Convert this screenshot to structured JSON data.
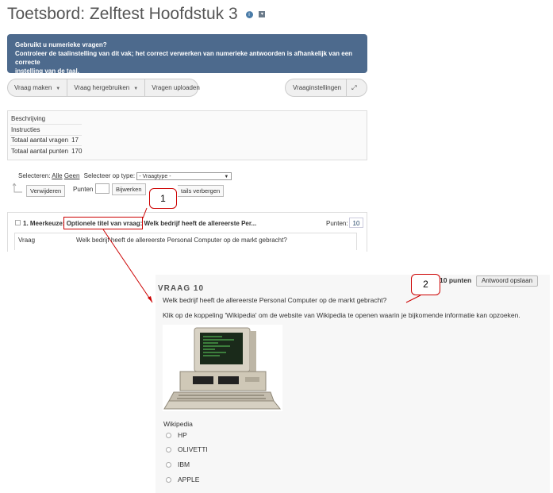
{
  "page": {
    "title": "Toetsbord: Zelftest Hoofdstuk 3"
  },
  "alert": {
    "line1": "Gebruikt u numerieke vragen?",
    "line2": "Controleer de taalinstelling van dit vak; het correct verwerken van numerieke antwoorden is afhankelijk van een correcte",
    "line3": "instelling van de taal."
  },
  "toolbar": {
    "vraag_maken": "Vraag maken",
    "vraag_hergebruiken": "Vraag hergebruiken",
    "vragen_uploaden": "Vragen uploaden",
    "vraaginstellingen": "Vraaginstellingen"
  },
  "info": {
    "beschrijving": "Beschrijving",
    "instructies": "Instructies",
    "totaal_vragen_label": "Totaal aantal vragen",
    "totaal_vragen": "17",
    "totaal_punten_label": "Totaal aantal punten",
    "totaal_punten": "170"
  },
  "selection": {
    "selecteren": "Selecteren:",
    "alle": "Alle",
    "geen": "Geen",
    "type_label": "Selecteer op type:",
    "type_value": "- Vraagtype -",
    "verwijderen": "Verwijderen",
    "punten": "Punten",
    "bijwerken": "Bijwerken",
    "details": "tails verbergen"
  },
  "question1": {
    "prefix": "1. Meerkeuze:",
    "optional_title": "Optionele titel van vraag:",
    "title_rest": "Welk bedrijf heeft de allereerste Per...",
    "points_label": "Punten:",
    "points": "10",
    "vraag_label": "Vraag",
    "vraag_text": "Welk bedrijf heeft de allereerste Personal Computer op de markt gebracht?"
  },
  "preview": {
    "heading": "VRAAG 10",
    "punten": "10 punten",
    "save": "Antwoord opslaan",
    "question": "Welk bedrijf heeft de allereerste Personal Computer op de markt gebracht?",
    "instruction": "Klik op de koppeling 'Wikipedia' om de website van Wikipedia te openen waarin je bijkomende informatie kan opzoeken.",
    "wiki_link": "Wikipedia",
    "options": [
      "HP",
      "OLIVETTI",
      "IBM",
      "APPLE"
    ]
  },
  "callouts": {
    "one": "1",
    "two": "2"
  },
  "colors": {
    "alert_bg": "#4d6a8d",
    "callout_border": "#cc0000",
    "title": "#555555"
  }
}
